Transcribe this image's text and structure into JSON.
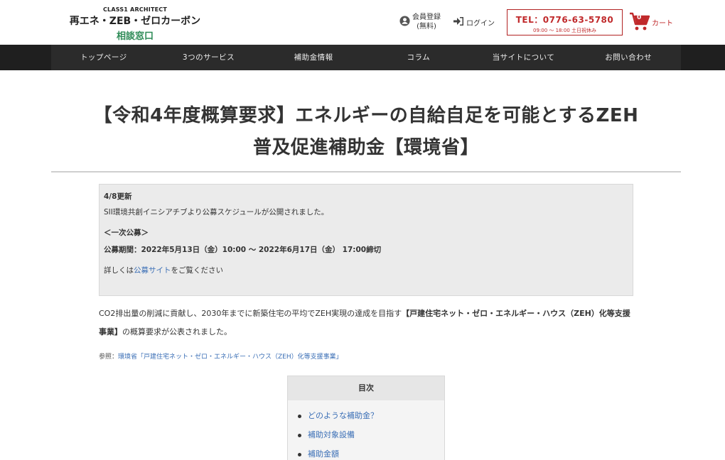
{
  "header": {
    "logo_small": "CLASS1 ARCHITECT",
    "logo_main": "再エネ・ZEB・ゼロカーボン",
    "logo_sub": "相談窓口",
    "member_line1": "会員登録",
    "member_line2": "(無料)",
    "login": "ログイン",
    "tel": "TEL：0776-63-5780",
    "tel_hours": "09:00 〜 18:00 土日祝休み",
    "cart_count": "0",
    "cart_label": "カート"
  },
  "nav": {
    "items": [
      "トップページ",
      "3つのサービス",
      "補助金情報",
      "コラム",
      "当サイトについて",
      "お問い合わせ"
    ]
  },
  "article": {
    "title_line1": "【令和4年度概算要求】エネルギーの自給自足を可能とするZEH",
    "title_line2": "普及促進補助金【環境省】",
    "notice": {
      "updated": "4/8更新",
      "line2": "SII環境共創イニシアチブより公募スケジュールが公開されました。",
      "round": "＜一次公募＞",
      "period": "公募期間：2022年5月13日（金）10:00 〜 2022年6月17日（金） 17:00締切",
      "detail_prefix": "詳しくは",
      "detail_link": "公募サイト",
      "detail_suffix": "をご覧ください"
    },
    "para_prefix": "CO2排出量の削減に貢献し、2030年までに新築住宅の平均でZEH実現の達成を目指す",
    "para_bold": "【戸建住宅ネット・ゼロ・エネルギー・ハウス（ZEH）化等支援事業】",
    "para_suffix": "の概算要求が公表されました。",
    "ref_label": "参照：",
    "ref_link": "環境省「戸建住宅ネット・ゼロ・エネルギー・ハウス（ZEH）化等支援事業」"
  },
  "toc": {
    "heading": "目次",
    "items": [
      "どのような補助金？",
      "補助対象設備",
      "補助金額"
    ]
  },
  "colors": {
    "nav_bg": "#2b2b2b",
    "accent_red": "#c0292b",
    "logo_green": "#2e8b57",
    "link_blue": "#3b6fb6"
  }
}
